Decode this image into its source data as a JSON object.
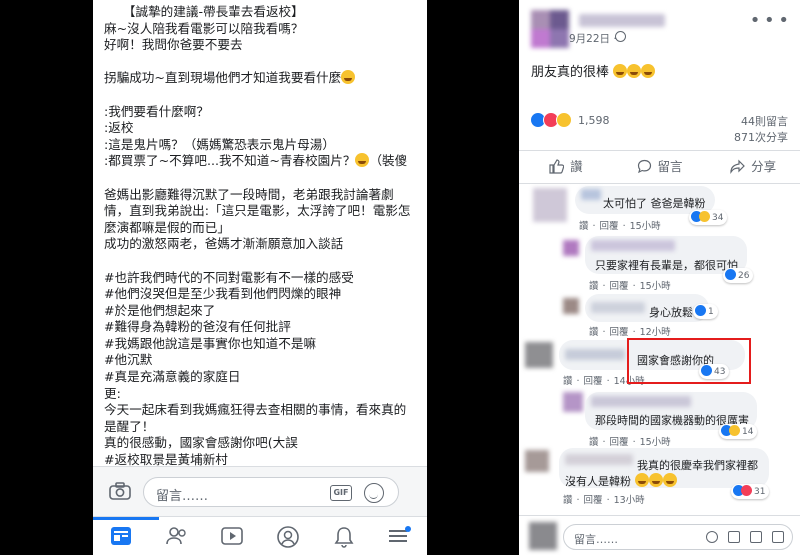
{
  "left": {
    "post_lines": [
      "　　【誠摯的建議-帶長輩去看返校】",
      "麻~沒人陪我看電影可以陪我看嗎？",
      "好啊！我問你爸要不要去",
      "",
      "拐騙成功~直到現場他們才知道我要看什麼",
      "",
      ":我們要看什麼啊？",
      ":返校",
      ":這是鬼片嗎？（媽媽驚恐表示鬼片母湯）",
      ":都買票了~不算吧...我不知道~青春校園片？",
      "",
      "爸媽出影廳難得沉默了一段時間，老弟跟我討論著劇",
      "情，直到我弟說出:「這只是電影，太浮誇了吧！電影怎",
      "麼演都嘛是假的而已」",
      "成功的激怒兩老，爸媽才漸漸願意加入談話",
      "",
      "#也許我們時代的不同對電影有不一樣的感受",
      "#他們沒哭但是至少我看到他們閃爍的眼神",
      "#於是他們想起來了",
      "#難得身為韓粉的爸沒有任何批評",
      "#我媽跟他說這是事實你也知道不是嘛",
      "#他沉默",
      "#真是充滿意義的家庭日",
      "更:",
      "今天一起床看到我媽瘋狂得去查相關的事情，看來真的",
      "是醒了！",
      "真的很感動，國家會感謝你吧(大誤",
      "#返校取景是黃埔新村"
    ],
    "post_line_suffix_10": "（裝傻",
    "comment_placeholder": "留言……",
    "gif_label": "GIF",
    "nav": [
      "home-icon",
      "friends-icon",
      "watch-icon",
      "profile-icon",
      "notifications-icon",
      "menu-icon"
    ]
  },
  "right": {
    "date": "9月22日 ·",
    "body": "朋友真的很棒",
    "reaction_count": "1,598",
    "comments_count": "44則留言",
    "shares_count": "871次分享",
    "actions": {
      "like": "讚",
      "comment": "留言",
      "share": "分享"
    },
    "comments": [
      {
        "text": "太可怕了 爸爸是韓粉",
        "like": "讚",
        "reply": "回覆",
        "time": "15小時",
        "reacts": "34"
      },
      {
        "text": "只要家裡有長輩是，都很可怕",
        "like": "讚",
        "reply": "回覆",
        "time": "15小時",
        "reacts": "26"
      },
      {
        "text": "身心放鬆",
        "like": "讚",
        "reply": "回覆",
        "time": "12小時",
        "reacts": "1"
      },
      {
        "text": "國家會感謝你的",
        "like": "讚",
        "reply": "回覆",
        "time": "14小時",
        "reacts": "43"
      },
      {
        "text": "那段時間的國家機器動的很厲害",
        "like": "讚",
        "reply": "回覆",
        "time": "15小時",
        "reacts": "14"
      },
      {
        "text1": "我真的很慶幸我們家裡都",
        "text2": "沒有人是韓粉",
        "like": "讚",
        "reply": "回覆",
        "time": "13小時",
        "reacts": "31"
      }
    ],
    "comment_placeholder": "留言……"
  },
  "colors": {
    "facebook_blue": "#1877f2",
    "highlight_red": "#e41c1c"
  }
}
